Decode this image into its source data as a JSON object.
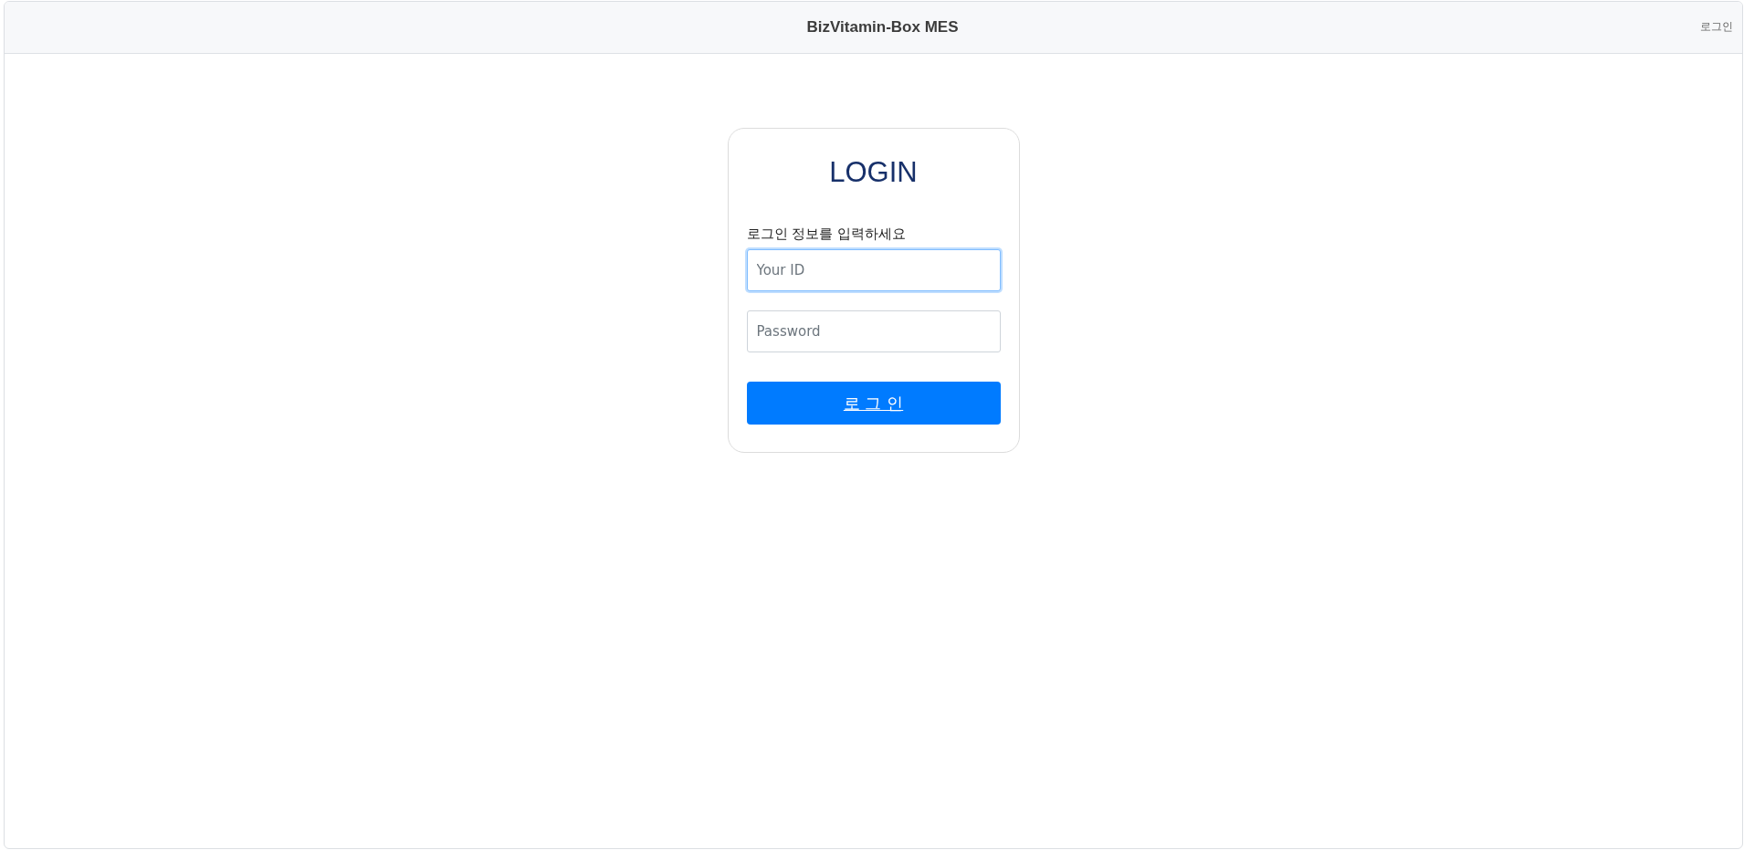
{
  "header": {
    "title": "BizVitamin-Box MES",
    "login_link": "로그인"
  },
  "login_card": {
    "title": "LOGIN",
    "prompt": "로그인 정보를 입력하세요",
    "fields": [
      {
        "placeholder": "Your ID",
        "focused": true
      },
      {
        "placeholder": "Password",
        "focused": false
      }
    ],
    "submit_button": "로 그 인"
  }
}
